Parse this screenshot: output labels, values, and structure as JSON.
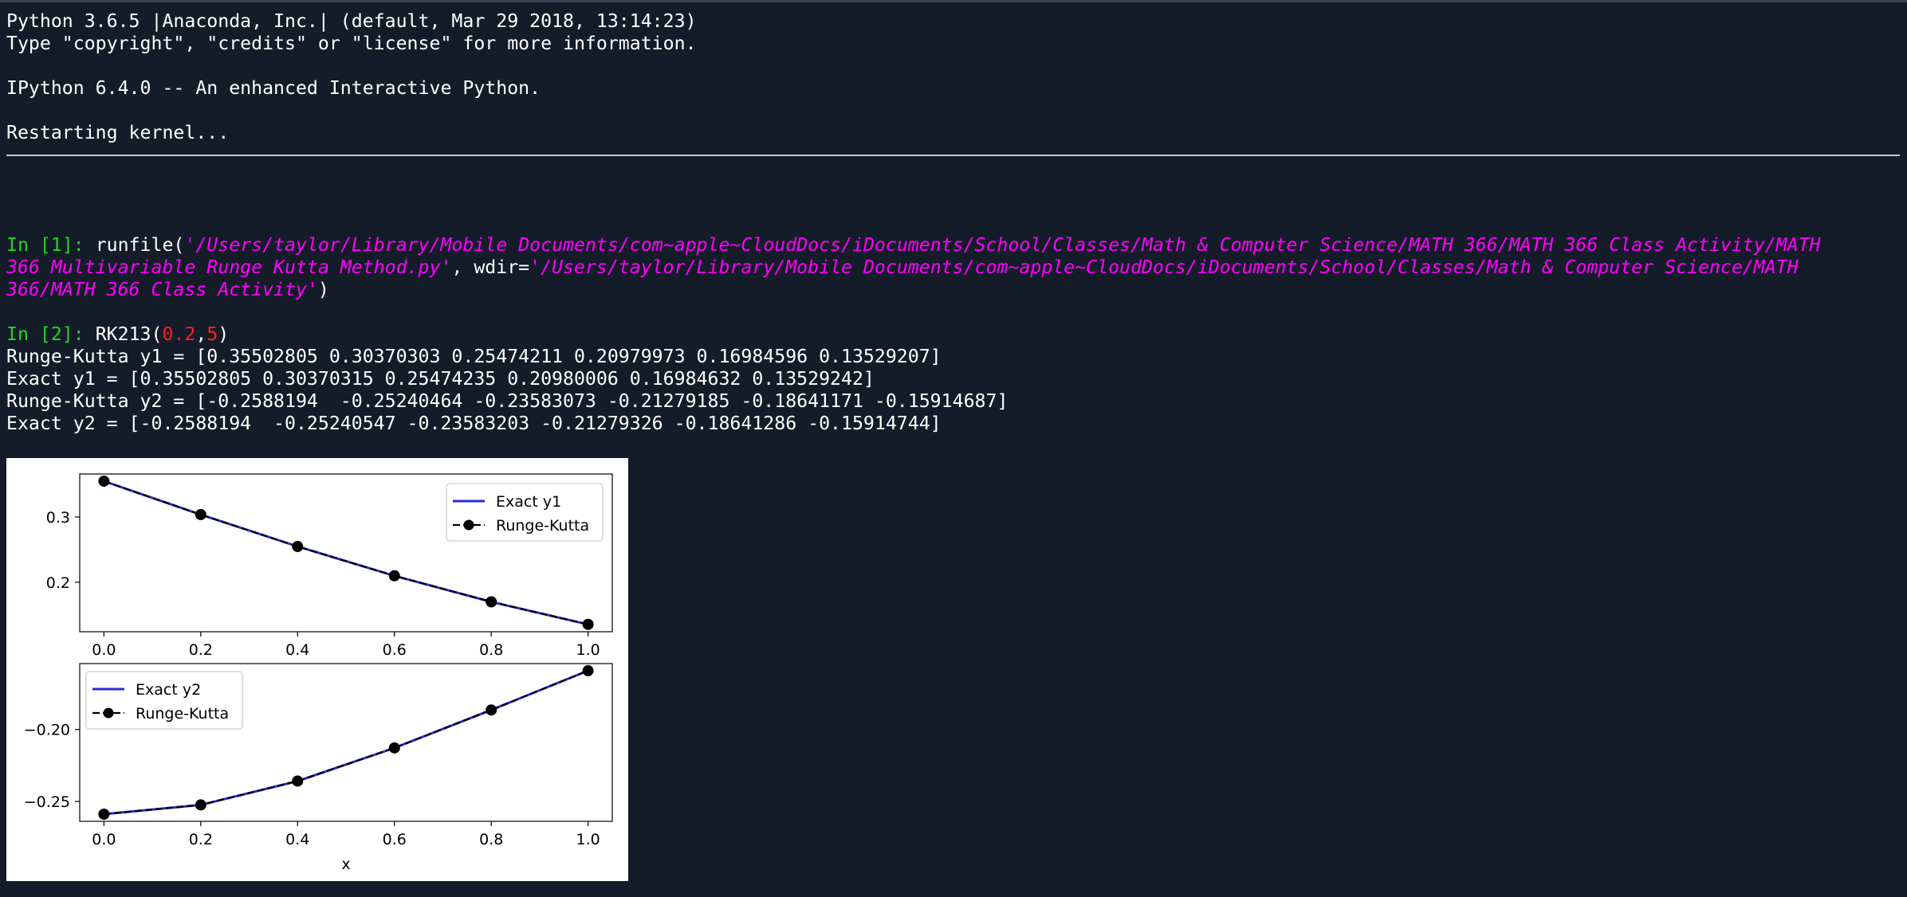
{
  "banner": {
    "line1": "Python 3.6.5 |Anaconda, Inc.| (default, Mar 29 2018, 13:14:23)",
    "line2": "Type \"copyright\", \"credits\" or \"license\" for more information.",
    "line3": "IPython 6.4.0 -- An enhanced Interactive Python.",
    "line4": "Restarting kernel..."
  },
  "cell1": {
    "prompt": "In [1]:",
    "func": "runfile(",
    "arg1_l1": "'/Users/taylor/Library/Mobile Documents/com~apple~CloudDocs/iDocuments/School/Classes/Math & Computer Science/MATH 366/MATH 366 Class Activity/MATH",
    "arg1_l2": "366 Multivariable Runge Kutta Method.py'",
    "sep": ", wdir=",
    "arg2_l2": "'/Users/taylor/Library/Mobile Documents/com~apple~CloudDocs/iDocuments/School/Classes/Math & Computer Science/MATH",
    "arg2_l3": "366/MATH 366 Class Activity'",
    "close": ")"
  },
  "cell2": {
    "prompt": "In [2]:",
    "func": "RK213(",
    "a1": "0.2",
    "comma": ",",
    "a2": "5",
    "close": ")",
    "out1": "Runge-Kutta y1 = [0.35502805 0.30370303 0.25474211 0.20979973 0.16984596 0.13529207]",
    "out2": "Exact y1 = [0.35502805 0.30370315 0.25474235 0.20980006 0.16984632 0.13529242]",
    "out3": "Runge-Kutta y2 = [-0.2588194  -0.25240464 -0.23583073 -0.21279185 -0.18641171 -0.15914687]",
    "out4": "Exact y2 = [-0.2588194  -0.25240547 -0.23583203 -0.21279326 -0.18641286 -0.15914744]"
  },
  "chart_data": [
    {
      "type": "line",
      "x": [
        0.0,
        0.2,
        0.4,
        0.6,
        0.8,
        1.0
      ],
      "series": [
        {
          "name": "Exact y1",
          "color": "#2b2bd6",
          "style": "solid",
          "values": [
            0.35502805,
            0.30370315,
            0.25474235,
            0.20980006,
            0.16984632,
            0.13529242
          ]
        },
        {
          "name": "Runge-Kutta",
          "color": "#000000",
          "style": "dashed-markers",
          "values": [
            0.35502805,
            0.30370303,
            0.25474211,
            0.20979973,
            0.16984596,
            0.13529207
          ]
        }
      ],
      "xticks": [
        "0.0",
        "0.2",
        "0.4",
        "0.6",
        "0.8",
        "1.0"
      ],
      "yticks": [
        "0.3",
        "0.2"
      ],
      "ytick_values": [
        0.3,
        0.2
      ],
      "xlim": [
        -0.05,
        1.05
      ],
      "ylim": [
        0.124,
        0.366
      ],
      "legend_position": "top-right",
      "xlabel": "",
      "ylabel": ""
    },
    {
      "type": "line",
      "x": [
        0.0,
        0.2,
        0.4,
        0.6,
        0.8,
        1.0
      ],
      "series": [
        {
          "name": "Exact y2",
          "color": "#2b2bd6",
          "style": "solid",
          "values": [
            -0.2588194,
            -0.25240547,
            -0.23583203,
            -0.21279326,
            -0.18641286,
            -0.15914744
          ]
        },
        {
          "name": "Runge-Kutta",
          "color": "#000000",
          "style": "dashed-markers",
          "values": [
            -0.2588194,
            -0.25240464,
            -0.23583073,
            -0.21279185,
            -0.18641171,
            -0.15914687
          ]
        }
      ],
      "xticks": [
        "0.0",
        "0.2",
        "0.4",
        "0.6",
        "0.8",
        "1.0"
      ],
      "yticks": [
        "-0.20",
        "-0.25"
      ],
      "ytick_values": [
        -0.2,
        -0.25
      ],
      "xlim": [
        -0.05,
        1.05
      ],
      "ylim": [
        -0.2638,
        -0.1542
      ],
      "legend_position": "top-left",
      "xlabel": "x",
      "ylabel": ""
    }
  ]
}
